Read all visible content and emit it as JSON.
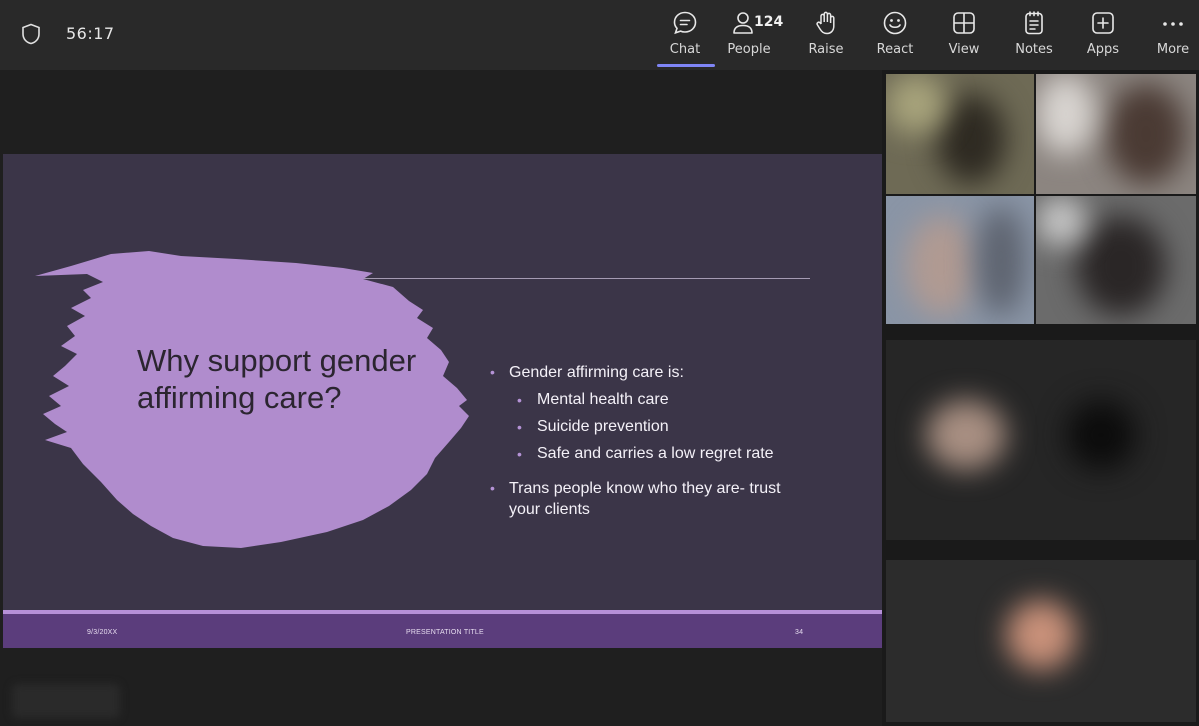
{
  "meeting": {
    "timer": "56:17"
  },
  "toolbar": {
    "buttons": [
      {
        "label": "Chat",
        "icon": "chat-icon"
      },
      {
        "label": "People",
        "icon": "people-icon",
        "count": "124"
      },
      {
        "label": "Raise",
        "icon": "raise-hand-icon"
      },
      {
        "label": "React",
        "icon": "smiley-icon"
      },
      {
        "label": "View",
        "icon": "view-grid-icon"
      },
      {
        "label": "Notes",
        "icon": "notes-icon"
      },
      {
        "label": "Apps",
        "icon": "apps-plus-icon"
      },
      {
        "label": "More",
        "icon": "more-ellipsis-icon"
      }
    ],
    "active": "Chat",
    "accent_color": "#7f85f5"
  },
  "slide": {
    "title": "Why support gender affirming care?",
    "bullets": {
      "b1": "Gender affirming care is:",
      "sub1": "Mental health care",
      "sub2": "Suicide prevention",
      "sub3": "Safe and carries a low regret rate",
      "b2": "Trans people know who they are- trust your clients"
    },
    "footer": {
      "date": "9/3/20XX",
      "presentation_title": "PRESENTATION TITLE",
      "page_number": "34"
    },
    "colors": {
      "background": "#3b3548",
      "brush": "#b08ccd",
      "footer_bar": "#5b3d7c"
    }
  },
  "gallery": {
    "tile_count": 5
  }
}
